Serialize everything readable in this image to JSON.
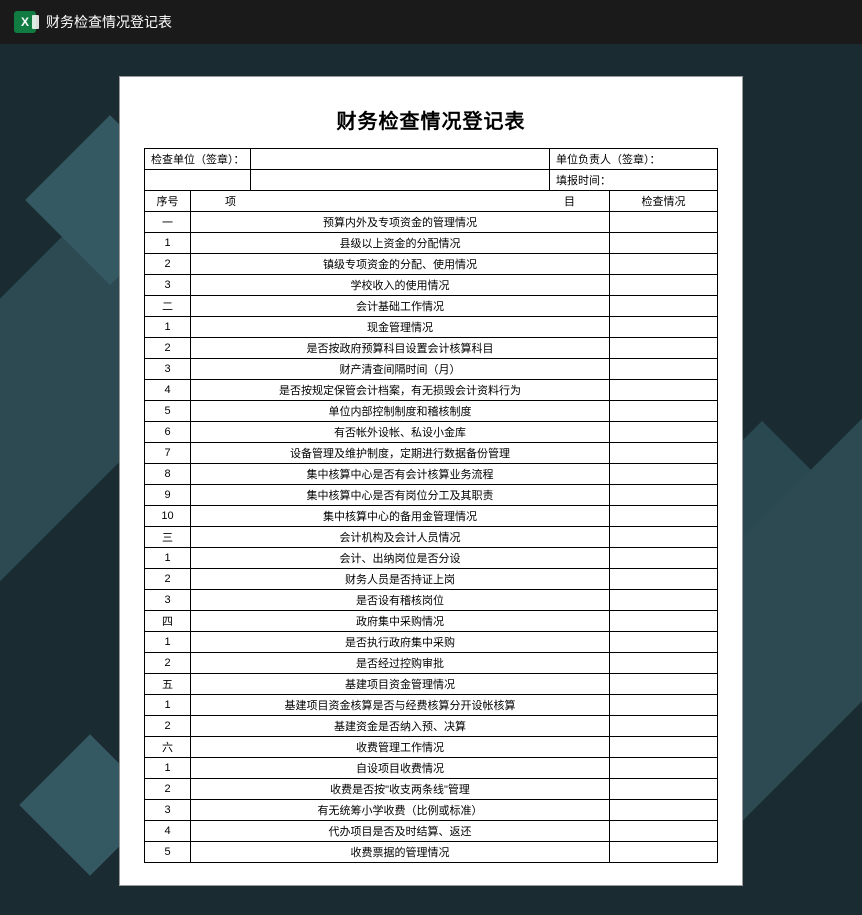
{
  "window": {
    "title": "财务检查情况登记表"
  },
  "document": {
    "title": "财务检查情况登记表",
    "info": {
      "inspect_unit_label": "检查单位（签章）：",
      "unit_head_label": "单位负责人（签章）：",
      "report_time_label": "填报时间："
    },
    "columns": {
      "seq": "序号",
      "item_left": "项",
      "item_right": "目",
      "status": "检查情况"
    },
    "rows": [
      {
        "seq": "一",
        "item": "预算内外及专项资金的管理情况"
      },
      {
        "seq": "1",
        "item": "县级以上资金的分配情况"
      },
      {
        "seq": "2",
        "item": "镇级专项资金的分配、使用情况"
      },
      {
        "seq": "3",
        "item": "学校收入的使用情况"
      },
      {
        "seq": "二",
        "item": "会计基础工作情况"
      },
      {
        "seq": "1",
        "item": "现金管理情况"
      },
      {
        "seq": "2",
        "item": "是否按政府预算科目设置会计核算科目"
      },
      {
        "seq": "3",
        "item": "财产清查间隔时间（月）"
      },
      {
        "seq": "4",
        "item": "是否按规定保管会计档案，有无损毁会计资料行为"
      },
      {
        "seq": "5",
        "item": "单位内部控制制度和稽核制度"
      },
      {
        "seq": "6",
        "item": "有否帐外设帐、私设小金库"
      },
      {
        "seq": "7",
        "item": "设备管理及维护制度，定期进行数据备份管理"
      },
      {
        "seq": "8",
        "item": "集中核算中心是否有会计核算业务流程"
      },
      {
        "seq": "9",
        "item": "集中核算中心是否有岗位分工及其职责"
      },
      {
        "seq": "10",
        "item": "集中核算中心的备用金管理情况"
      },
      {
        "seq": "三",
        "item": "会计机构及会计人员情况"
      },
      {
        "seq": "1",
        "item": "会计、出纳岗位是否分设"
      },
      {
        "seq": "2",
        "item": "财务人员是否持证上岗"
      },
      {
        "seq": "3",
        "item": "是否设有稽核岗位"
      },
      {
        "seq": "四",
        "item": "政府集中采购情况"
      },
      {
        "seq": "1",
        "item": "是否执行政府集中采购"
      },
      {
        "seq": "2",
        "item": "是否经过控购审批"
      },
      {
        "seq": "五",
        "item": "基建项目资金管理情况"
      },
      {
        "seq": "1",
        "item": "基建项目资金核算是否与经费核算分开设帐核算"
      },
      {
        "seq": "2",
        "item": "基建资金是否纳入预、决算"
      },
      {
        "seq": "六",
        "item": "收费管理工作情况"
      },
      {
        "seq": "1",
        "item": "自设项目收费情况"
      },
      {
        "seq": "2",
        "item": "收费是否按\"收支两条线\"管理"
      },
      {
        "seq": "3",
        "item": "有无统筹小学收费（比例或标准）"
      },
      {
        "seq": "4",
        "item": "代办项目是否及时结算、返还"
      },
      {
        "seq": "5",
        "item": "收费票据的管理情况"
      }
    ]
  }
}
